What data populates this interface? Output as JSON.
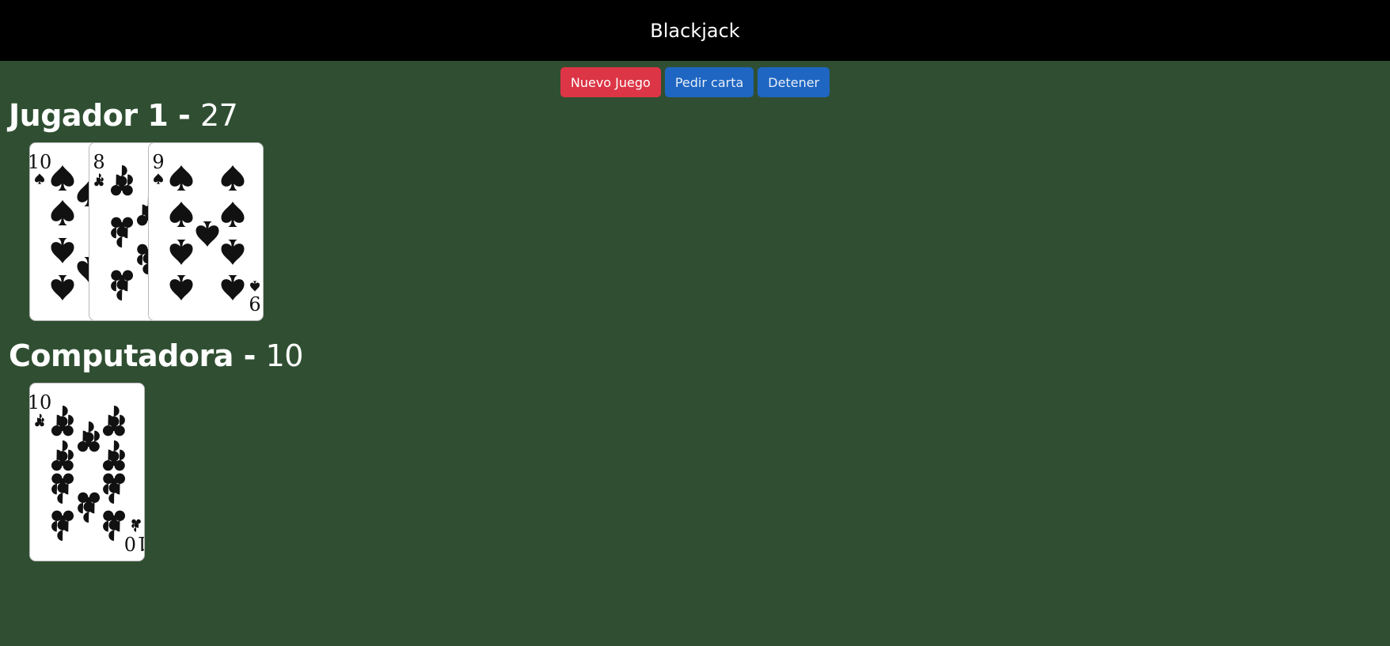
{
  "app": {
    "title": "Blackjack"
  },
  "controls": {
    "new_game": "Nuevo Juego",
    "hit": "Pedir carta",
    "stand": "Detener"
  },
  "player": {
    "name": "Jugador 1",
    "separator": " - ",
    "score": "27",
    "cards": [
      {
        "rank": "10",
        "suit": "spades"
      },
      {
        "rank": "8",
        "suit": "clubs"
      },
      {
        "rank": "9",
        "suit": "spades"
      }
    ]
  },
  "computer": {
    "name": "Computadora",
    "separator": " - ",
    "score": "10",
    "cards": [
      {
        "rank": "10",
        "suit": "clubs"
      }
    ]
  },
  "colors": {
    "table": "#304f32",
    "header": "#000000",
    "new_game": "#dc3545",
    "action": "#1e66c2",
    "card_ink": "#111111"
  }
}
